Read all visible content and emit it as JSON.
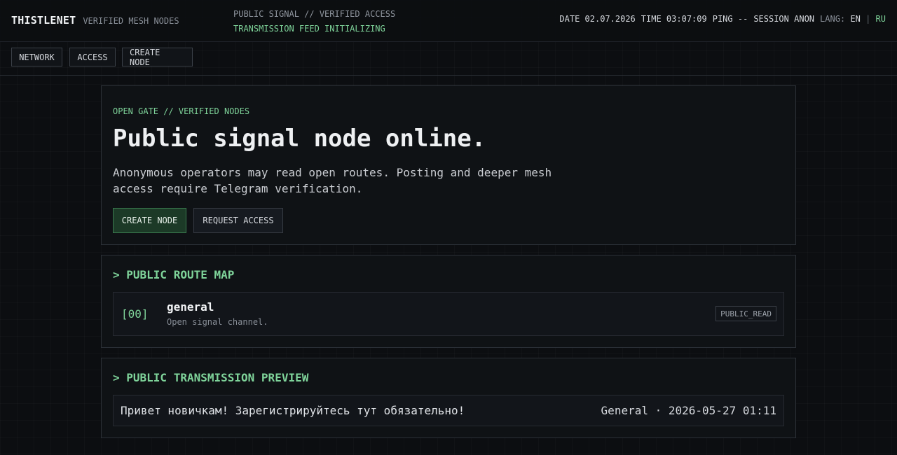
{
  "header": {
    "brand": "THISTLENET",
    "brand_sub": "VERIFIED MESH NODES",
    "signal_line1": "PUBLIC SIGNAL // VERIFIED ACCESS",
    "signal_line2": "TRANSMISSION FEED INITIALIZING",
    "status": {
      "date_label": "DATE",
      "date": "02.07.2026",
      "time_label": "TIME",
      "time": "03:07:09",
      "ping_label": "PING",
      "ping": "--",
      "session_label": "SESSION",
      "session": "ANON",
      "lang_label": "LANG:",
      "lang_en": "EN",
      "lang_sep": "|",
      "lang_ru": "RU"
    }
  },
  "nav": {
    "items": [
      {
        "label": "NETWORK"
      },
      {
        "label": "ACCESS"
      },
      {
        "label": "CREATE NODE"
      }
    ]
  },
  "hero": {
    "kicker": "OPEN GATE // VERIFIED NODES",
    "title": "Public signal node online.",
    "description": "Anonymous operators may read open routes. Posting and deeper mesh access require Telegram verification.",
    "primary_button": "CREATE NODE",
    "secondary_button": "REQUEST ACCESS"
  },
  "routes": {
    "title": "> PUBLIC ROUTE MAP",
    "items": [
      {
        "index": "[00]",
        "name": "general",
        "description": "Open signal channel.",
        "badge": "PUBLIC_READ"
      }
    ]
  },
  "transmissions": {
    "title": "> PUBLIC TRANSMISSION PREVIEW",
    "items": [
      {
        "text": "Привет новичкам! Зарегистрируйтесь тут обязательно!",
        "meta": "General · 2026-05-27 01:11"
      }
    ]
  },
  "colors": {
    "accent": "#7fd49a",
    "background": "#0c0e11",
    "panel": "#0f1215",
    "primary_button_bg": "#1c3a27"
  }
}
